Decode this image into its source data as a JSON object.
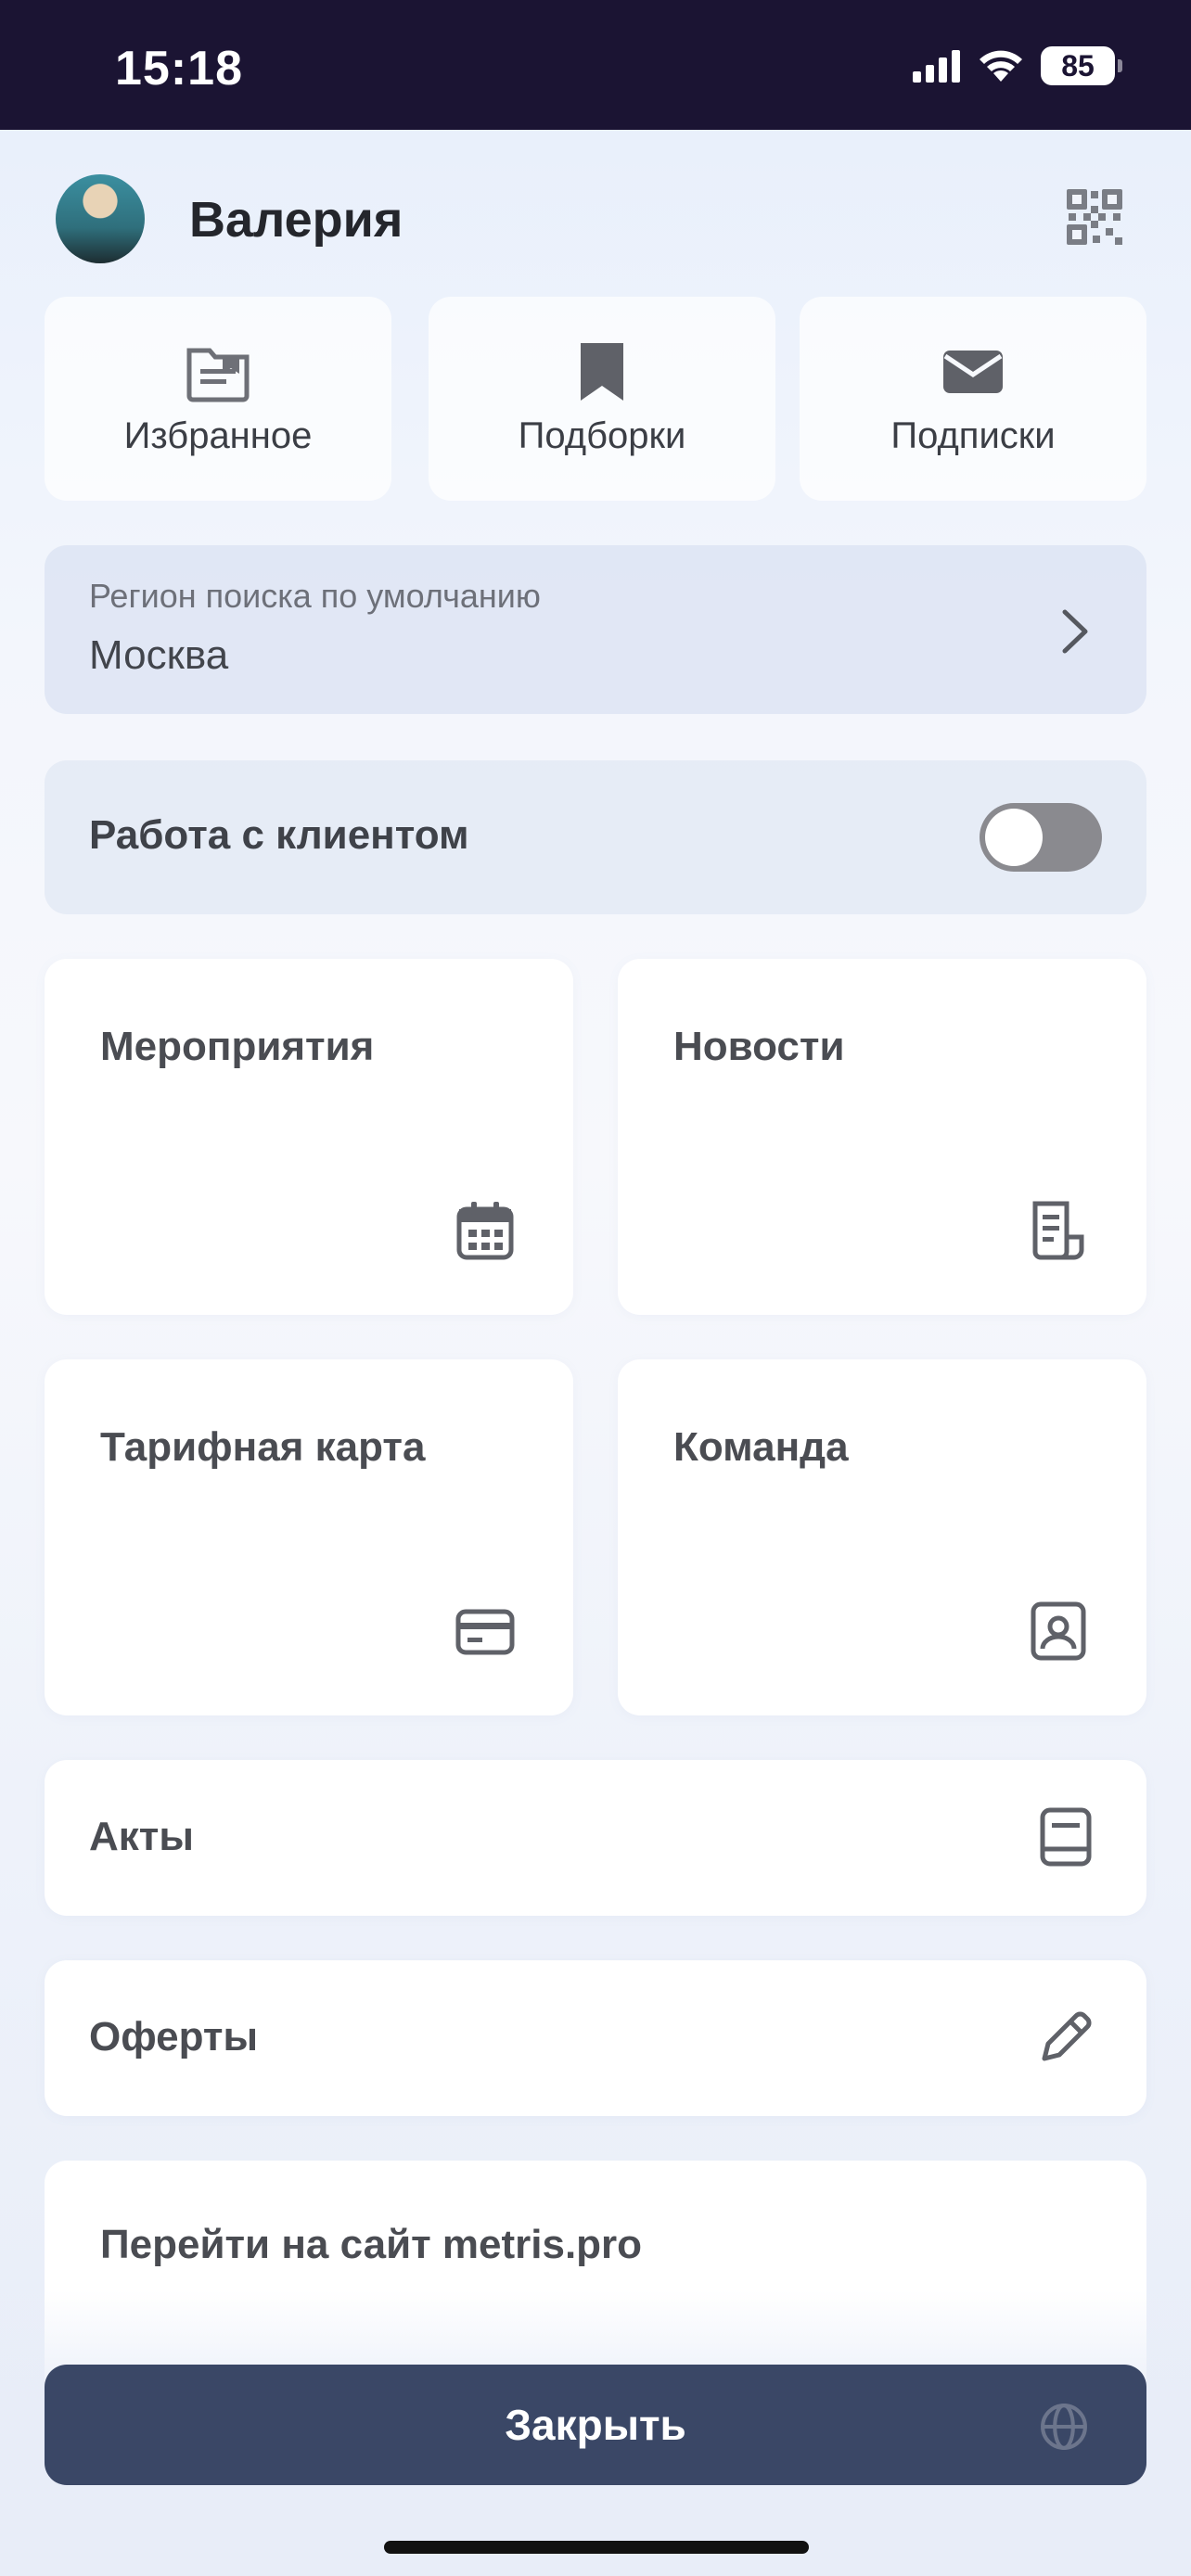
{
  "status_bar": {
    "time": "15:18",
    "battery": "85"
  },
  "header": {
    "user_name": "Валерия"
  },
  "quick_actions": [
    {
      "label": "Избранное",
      "icon": "folder-icon"
    },
    {
      "label": "Подборки",
      "icon": "bookmark-icon"
    },
    {
      "label": "Подписки",
      "icon": "envelope-icon"
    }
  ],
  "region": {
    "label": "Регион поиска по умолчанию",
    "value": "Москва"
  },
  "client_mode": {
    "label": "Работа с клиентом",
    "enabled": false
  },
  "tiles": [
    {
      "label": "Мероприятия",
      "icon": "calendar-icon"
    },
    {
      "label": "Новости",
      "icon": "news-icon"
    },
    {
      "label": "Тарифная карта",
      "icon": "credit-card-icon"
    },
    {
      "label": "Команда",
      "icon": "contact-card-icon"
    }
  ],
  "rows": [
    {
      "label": "Акты",
      "icon": "book-icon"
    },
    {
      "label": "Оферты",
      "icon": "pencil-icon"
    }
  ],
  "site_link": {
    "label": "Перейти на сайт metris.pro",
    "icon": "globe-icon"
  },
  "close_button": {
    "label": "Закрыть"
  },
  "colors": {
    "status_bar": "#1b1433",
    "close_button": "#3a4766",
    "toggle_off": "#8a8a8f"
  }
}
